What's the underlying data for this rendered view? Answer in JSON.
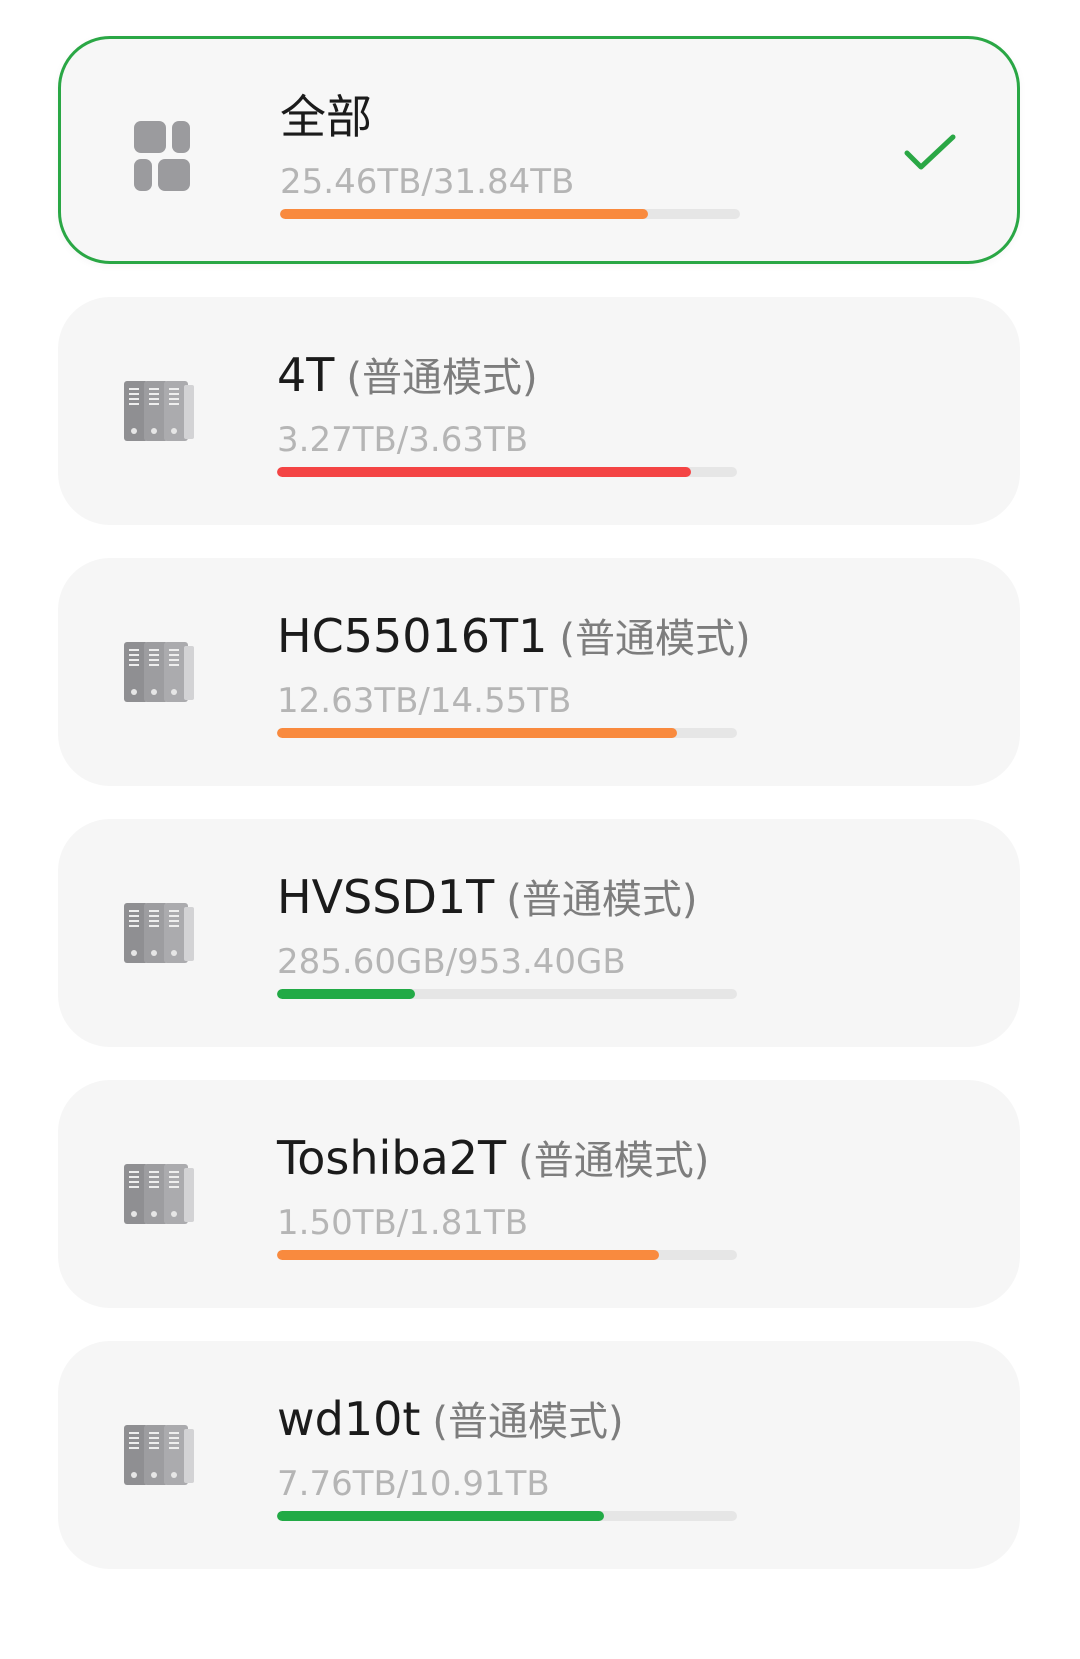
{
  "pools": [
    {
      "name": "全部",
      "mode": "",
      "usage": "25.46TB/31.84TB",
      "fill_fraction": 0.8,
      "fill_color": "#f98a3e",
      "selected": true,
      "icon": "all-grid-icon"
    },
    {
      "name": "4T",
      "mode": "(普通模式)",
      "usage": "3.27TB/3.63TB",
      "fill_fraction": 0.9,
      "fill_color": "#f44444",
      "selected": false,
      "icon": "storage-pool-icon"
    },
    {
      "name": "HC55016T1",
      "mode": "(普通模式)",
      "usage": "12.63TB/14.55TB",
      "fill_fraction": 0.87,
      "fill_color": "#f98a3e",
      "selected": false,
      "icon": "storage-pool-icon"
    },
    {
      "name": "HVSSD1T",
      "mode": "(普通模式)",
      "usage": "285.60GB/953.40GB",
      "fill_fraction": 0.3,
      "fill_color": "#22aa46",
      "selected": false,
      "icon": "storage-pool-icon"
    },
    {
      "name": "Toshiba2T",
      "mode": "(普通模式)",
      "usage": "1.50TB/1.81TB",
      "fill_fraction": 0.83,
      "fill_color": "#f98a3e",
      "selected": false,
      "icon": "storage-pool-icon"
    },
    {
      "name": "wd10t",
      "mode": "(普通模式)",
      "usage": "7.76TB/10.91TB",
      "fill_fraction": 0.71,
      "fill_color": "#22aa46",
      "selected": false,
      "icon": "storage-pool-icon"
    }
  ],
  "colors": {
    "selected_border": "#2aa745",
    "check": "#2aa745",
    "track": "#e6e6e6"
  },
  "selected_icon": "checkmark-icon"
}
